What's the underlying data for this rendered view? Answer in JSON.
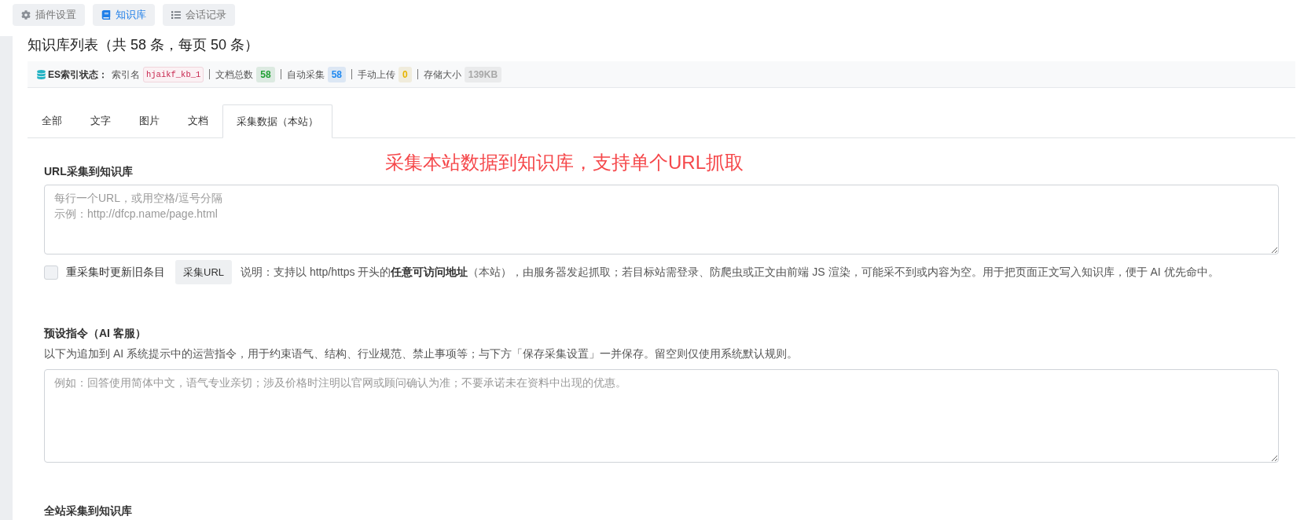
{
  "nav": [
    {
      "label": "插件设置",
      "selected": false
    },
    {
      "label": "知识库",
      "selected": true
    },
    {
      "label": "会话记录",
      "selected": false
    }
  ],
  "page": {
    "title": "知识库列表（共 58 条，每页 50 条）"
  },
  "es_status": {
    "title": "ES索引状态：",
    "fields": [
      {
        "label": "索引名",
        "value": "hjaikf_kb_1",
        "kind": "code",
        "color": "#c7254e"
      },
      {
        "label": "文档总数",
        "value": "58",
        "kind": "badge",
        "color": "#22a034"
      },
      {
        "label": "自动采集",
        "value": "58",
        "kind": "badge",
        "color": "#1e88f0"
      },
      {
        "label": "手动上传",
        "value": "0",
        "kind": "badge",
        "color": "#e6b400"
      },
      {
        "label": "存储大小",
        "value": "139KB",
        "kind": "badge",
        "color": "#a8a8a8"
      }
    ]
  },
  "tabs": [
    {
      "label": "全部",
      "selected": false
    },
    {
      "label": "文字",
      "selected": false
    },
    {
      "label": "图片",
      "selected": false
    },
    {
      "label": "文档",
      "selected": false
    },
    {
      "label": "采集数据（本站）",
      "selected": true
    }
  ],
  "annotation": {
    "text": "采集本站数据到知识库，支持单个URL抓取"
  },
  "url_section": {
    "label": "URL采集到知识库",
    "input": {
      "placeholder": [
        "每行一个URL，或用空格/逗号分隔",
        "示例：http://dfcp.name/page.html"
      ]
    },
    "update_existing": {
      "label": "重采集时更新旧条目",
      "checked": false
    },
    "button": "采集URL",
    "note": "说明：支持以 http/https 开头的**任意可访问地址**（本站），由服务器发起抓取；若目标站需登录、防爬虫或正文由前端 JS 渲染，可能采不到或内容为空。用于把页面正文写入知识库，便于 AI 优先命中。"
  },
  "preset_section": {
    "label": "预设指令（AI 客服）",
    "description": "以下为追加到 AI 系统提示中的运营指令，用于约束语气、结构、行业规范、禁止事项等；与下方「保存采集设置」一并保存。留空则仅使用系统默认规则。",
    "input": {
      "placeholder": "例如：回答使用简体中文，语气专业亲切；涉及价格时注明以官网或顾问确认为准；不要承诺未在资料中出现的优惠。"
    }
  },
  "site_section": {
    "label": "全站采集到知识库"
  }
}
